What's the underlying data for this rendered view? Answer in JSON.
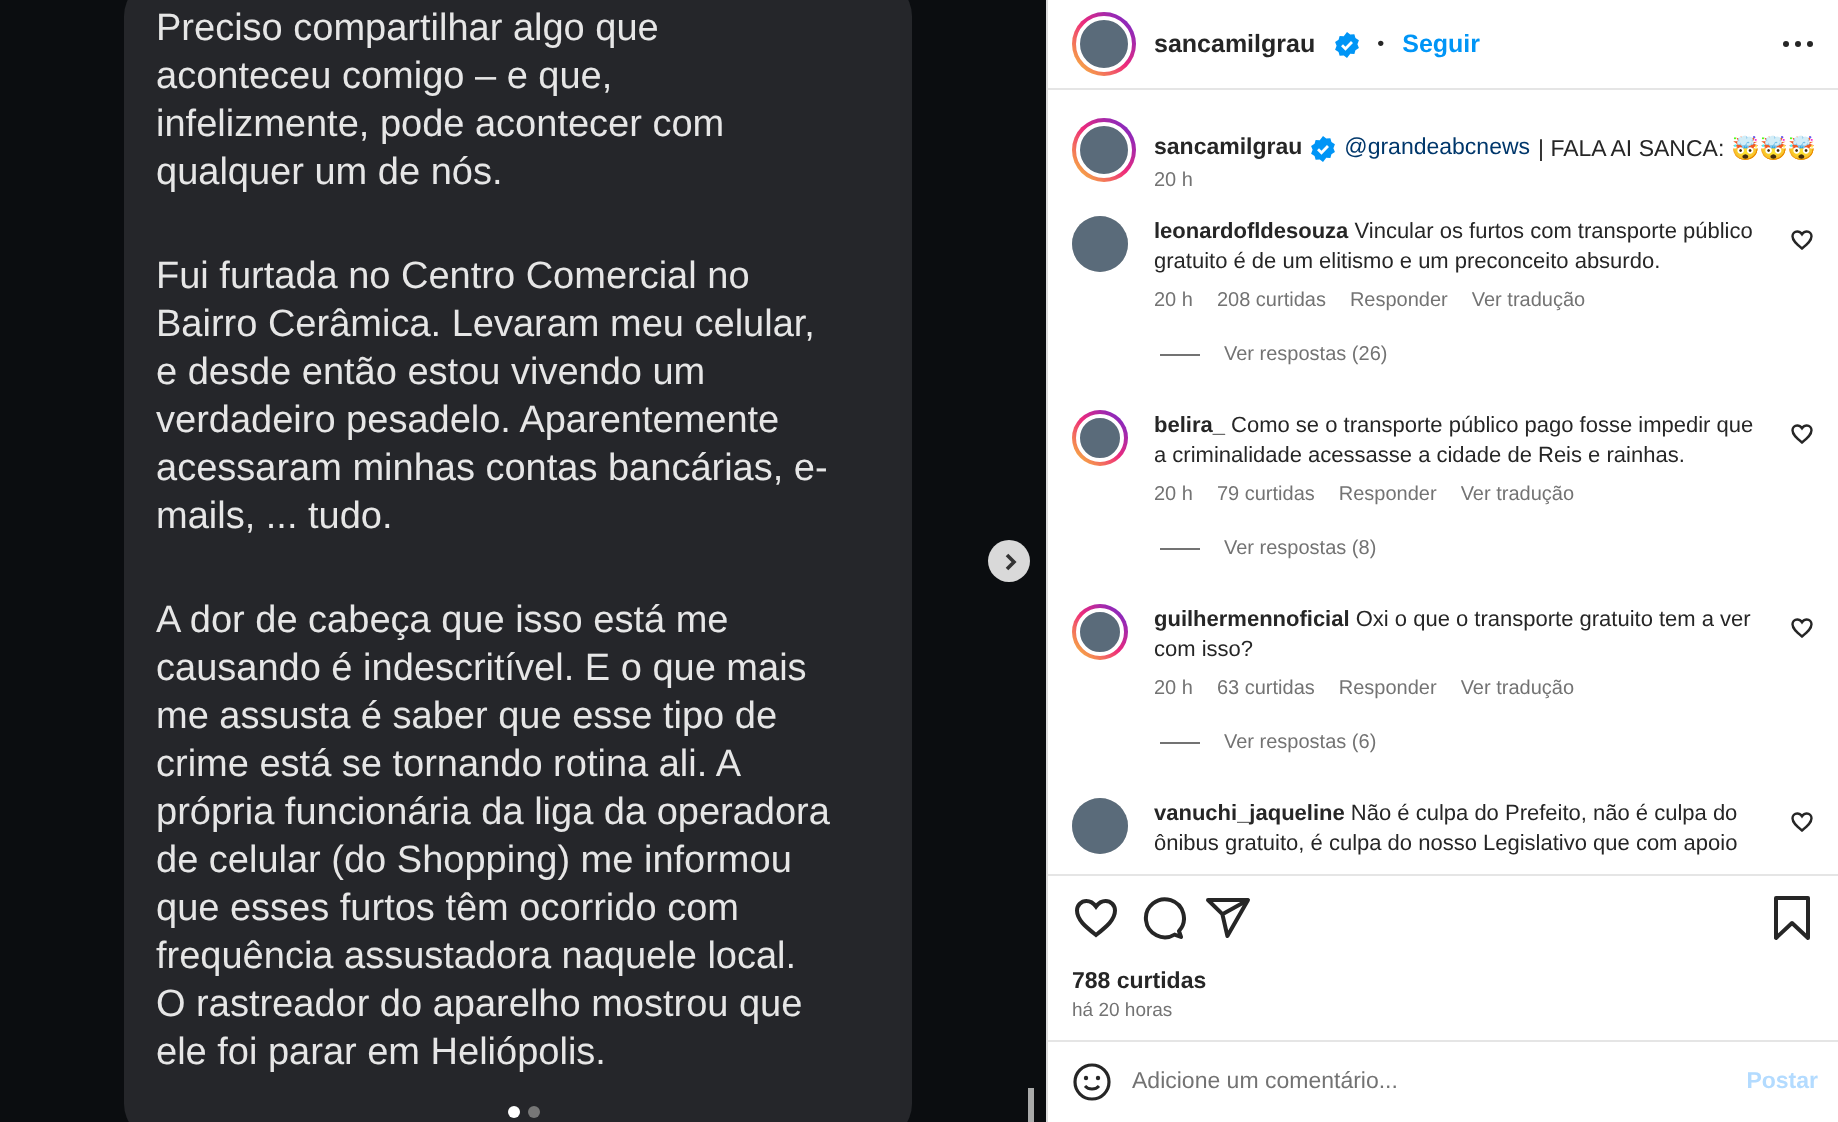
{
  "post_image": {
    "paragraphs": [
      "Preciso compartilhar algo que\naconteceu comigo – e que,\ninfelizmente, pode acontecer com\nqualquer um de nós.",
      "Fui furtada no Centro Comercial no\nBairro Cerâmica. Levaram meu celular,\ne desde então estou vivendo um\nverdadeiro pesadelo. Aparentemente\nacessaram minhas contas bancárias, e-\nmails, ... tudo.",
      "A dor de cabeça que isso está me\ncausando é indescritível. E o que mais\nme assusta é saber que esse tipo de\ncrime está se tornando rotina ali. A\nprópria funcionária da liga da operadora\nde celular (do Shopping) me informou\nque esses furtos têm ocorrido com\nfrequência assustadora naquele local.\nO rastreador do aparelho mostrou que\nele foi parar em Heliópolis."
    ],
    "slide_dots": [
      {
        "selected": true
      },
      {
        "selected": false
      }
    ]
  },
  "header": {
    "username": "sancamilgrau",
    "verified": true,
    "separator": "•",
    "follow": "Seguir"
  },
  "caption": {
    "username": "sancamilgrau",
    "verified": true,
    "mention": "@grandeabcnews",
    "text": "| FALA AI SANCA: 🤯🤯🤯",
    "time": "20 h"
  },
  "comments": [
    {
      "username": "leonardofldesouza",
      "text": "Vincular os furtos com transporte público gratuito é de um elitismo e um preconceito absurdo.",
      "story_ring": false,
      "time": "20 h",
      "likes": "208 curtidas",
      "reply": "Responder",
      "translate": "Ver tradução",
      "replies": "Ver respostas (26)"
    },
    {
      "username": "belira_",
      "text": "Como se o transporte público pago fosse impedir que a criminalidade acessasse a cidade de Reis e rainhas.",
      "story_ring": true,
      "time": "20 h",
      "likes": "79 curtidas",
      "reply": "Responder",
      "translate": "Ver tradução",
      "replies": "Ver respostas (8)"
    },
    {
      "username": "guilhermennoficial",
      "text": "Oxi o que o transporte gratuito tem a ver com isso?",
      "story_ring": true,
      "time": "20 h",
      "likes": "63 curtidas",
      "reply": "Responder",
      "translate": "Ver tradução",
      "replies": "Ver respostas (6)"
    },
    {
      "username": "vanuchi_jaqueline",
      "text": "Não é culpa do Prefeito, não é culpa do ônibus gratuito, é culpa do nosso Legislativo que com apoio",
      "story_ring": false
    }
  ],
  "likes": "788 curtidas",
  "posted": "há 20 horas",
  "comment_field": {
    "placeholder": "Adicione um comentário...",
    "submit": "Postar"
  }
}
